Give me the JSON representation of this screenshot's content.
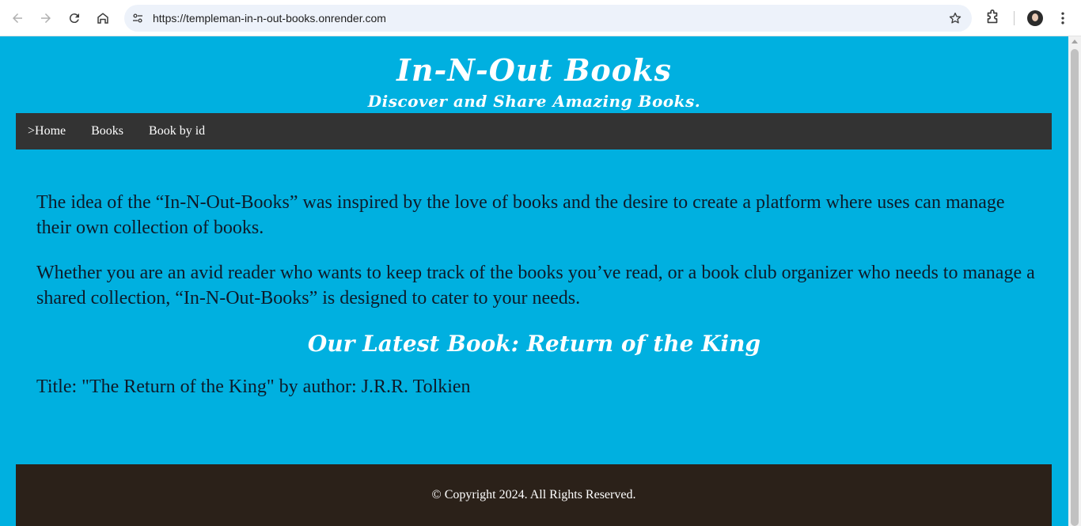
{
  "browser": {
    "url": "https://templeman-in-n-out-books.onrender.com",
    "icons": {
      "back": "arrow-left-icon",
      "forward": "arrow-right-icon",
      "reload": "reload-icon",
      "home": "home-icon",
      "site_info": "tune-icon",
      "bookmark": "star-icon",
      "extensions": "puzzle-icon",
      "profile": "avatar",
      "menu": "kebab-menu-icon"
    }
  },
  "site": {
    "title": "In-N-Out Books",
    "tagline": "Discover and Share Amazing Books."
  },
  "nav": {
    "items": [
      ">Home",
      "Books",
      "Book by id"
    ]
  },
  "content": {
    "paragraph1": "The idea of the “In-N-Out-Books” was inspired by the love of books and the desire to create a platform where uses can manage their own collection of books.",
    "paragraph2": "Whether you are an avid reader who wants to keep track of the books you’ve read, or a book club organizer who needs to manage a shared collection, “In-N-Out-Books” is designed to cater to your needs.",
    "latest_heading": "Our Latest Book: Return of the King",
    "book_line": "Title: \"The Return of the King\" by author: J.R.R. Tolkien"
  },
  "footer": {
    "copyright": "© Copyright 2024. All Rights Reserved."
  },
  "colors": {
    "page_background": "#00b0e0",
    "nav_background": "#333333",
    "footer_background": "#2b2119",
    "body_text": "#0d1b2a",
    "heading_text": "#ffffff"
  }
}
